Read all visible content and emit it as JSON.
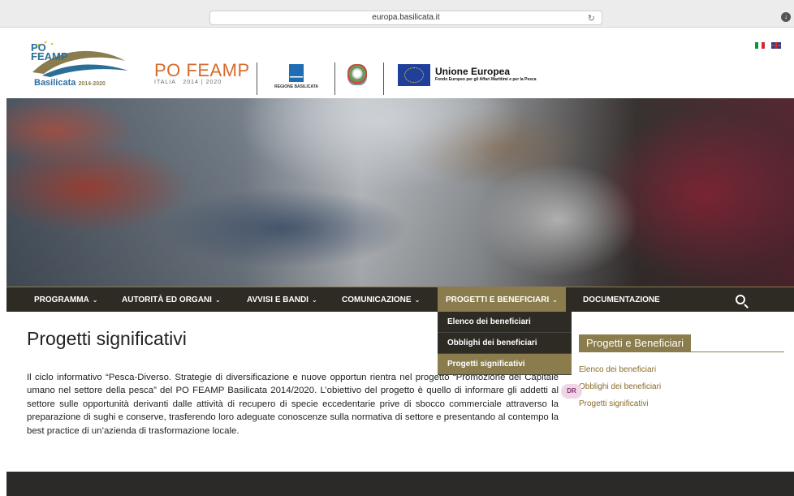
{
  "browser": {
    "url": "europa.basilicata.it",
    "reload_icon": "reload-icon",
    "download_icon": "download-icon"
  },
  "header": {
    "logo": {
      "po_text": "PO\nFEAMP",
      "region": "Basilicata",
      "years": "2014-2020"
    },
    "feamp": {
      "title": "PO FEAMP",
      "subtitle": "ITALIA   2014 | 2020"
    },
    "regione_label": "REGIONE BASILICATA",
    "eu": {
      "title": "Unione Europea",
      "subtitle": "Fondo Europeo per gli Affari Marittimi e per la Pesca"
    },
    "languages": [
      "it-flag-icon",
      "uk-flag-icon"
    ]
  },
  "nav": {
    "items": [
      {
        "label": "PROGRAMMA",
        "has_chevron": true
      },
      {
        "label": "AUTORITÀ ED ORGANI",
        "has_chevron": true
      },
      {
        "label": "AVVISI E BANDI",
        "has_chevron": true
      },
      {
        "label": "COMUNICAZIONE",
        "has_chevron": true
      },
      {
        "label": "PROGETTI E BENEFICIARI",
        "has_chevron": true
      },
      {
        "label": "DOCUMENTAZIONE",
        "has_chevron": false
      }
    ],
    "active_index": 4,
    "search_icon": "search-icon"
  },
  "dropdown": {
    "items": [
      {
        "label": "Elenco dei beneficiari"
      },
      {
        "label": "Obblighi dei beneficiari"
      },
      {
        "label": "Progetti significativi"
      }
    ],
    "selected_index": 2
  },
  "main": {
    "title": "Progetti significativi",
    "text": "Il ciclo informativo “Pesca-Diverso. Strategie di diversificazione e nuove opportun rientra nel progetto “Promozione del Capitale umano nel settore della pesca” del PO FEAMP Basilicata 2014/2020. L’obiettivo del progetto è quello di informare gli addetti al settore sulle opportunità derivanti dalle attività di recupero di specie eccedentarie prive di sbocco commerciale attraverso la preparazione di sughi e conserve, trasferendo loro adeguate conoscenze sulla normativa di settore e presentando al contempo la best practice di un’azienda di trasformazione locale."
  },
  "sidebar": {
    "title": "Progetti e Beneficiari",
    "links": [
      {
        "label": "Elenco dei beneficiari"
      },
      {
        "label": "Obblighi dei beneficiari"
      },
      {
        "label": "Progetti significativi"
      }
    ]
  },
  "badge": "DR",
  "colors": {
    "accent": "#8a7c4c",
    "nav_bg": "#2e2a24",
    "link": "#8a6a2a"
  }
}
